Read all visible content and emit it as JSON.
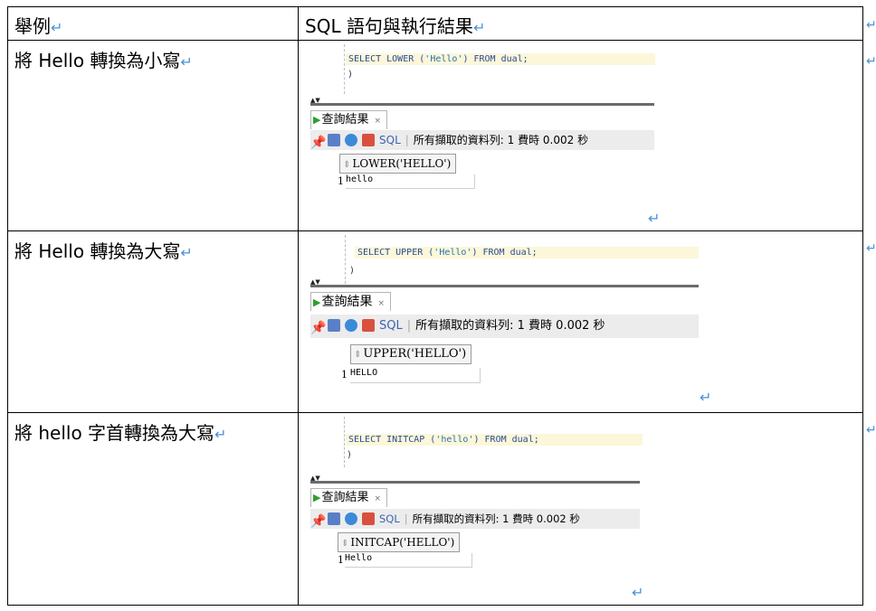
{
  "header": {
    "col1": "舉例",
    "col2": "SQL 語句與執行結果"
  },
  "return_mark": "↵",
  "rows": [
    {
      "label": "將 Hello 轉換為小寫",
      "sql": {
        "kw1": "SELECT LOWER (",
        "arg": "'Hello'",
        "kw2": ") FROM dual;"
      },
      "close_paren": ")",
      "tab": {
        "label": "查詢結果",
        "close": "×"
      },
      "toolbar": {
        "sql": "SQL",
        "status": "所有擷取的資料列: 1 費時 0.002 秒"
      },
      "column": "LOWER('HELLO')",
      "row_number": "1",
      "value": "hello"
    },
    {
      "label": "將 Hello 轉換為大寫",
      "sql": {
        "kw1": "SELECT UPPER (",
        "arg": "'Hello'",
        "kw2": ") FROM dual;"
      },
      "close_paren": ")",
      "tab": {
        "label": "查詢結果",
        "close": "×"
      },
      "toolbar": {
        "sql": "SQL",
        "status": "所有擷取的資料列: 1 費時 0.002 秒"
      },
      "column": "UPPER('HELLO')",
      "row_number": "1",
      "value": "HELLO"
    },
    {
      "label": "將 hello 字首轉換為大寫",
      "sql": {
        "kw1": "SELECT INITCAP (",
        "arg": "'hello'",
        "kw2": ") FROM dual;"
      },
      "close_paren": ")",
      "tab": {
        "label": "查詢結果",
        "close": "×"
      },
      "toolbar": {
        "sql": "SQL",
        "status": "所有擷取的資料列: 1 費時 0.002 秒"
      },
      "column": "INITCAP('HELLO')",
      "row_number": "1",
      "value": "Hello"
    }
  ],
  "colors": {
    "return_mark": "#4a90d9",
    "code_highlight": "#fbf7d8",
    "run_icon": "#2ea02e"
  }
}
